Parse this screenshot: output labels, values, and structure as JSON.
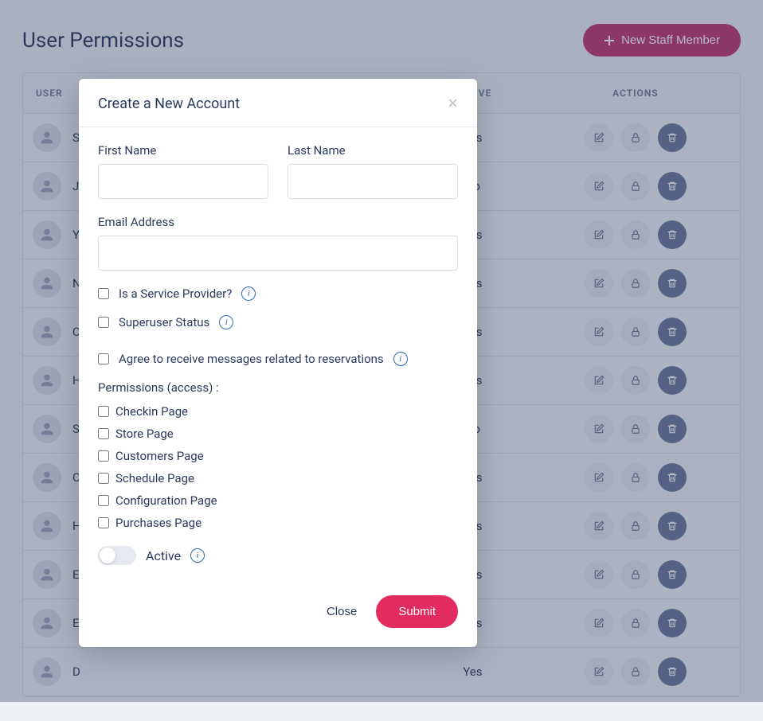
{
  "header": {
    "title": "User Permissions",
    "new_btn": "New Staff Member"
  },
  "table": {
    "columns": {
      "user": "USER",
      "sp": "?",
      "active": "ACTIVE",
      "actions": "ACTIONS"
    },
    "rows": [
      {
        "name": "S",
        "active": "Yes"
      },
      {
        "name": "J",
        "active": "No"
      },
      {
        "name": "Y",
        "active": "Yes"
      },
      {
        "name": "N",
        "active": "Yes"
      },
      {
        "name": "C",
        "active": "Yes"
      },
      {
        "name": "H",
        "active": "Yes"
      },
      {
        "name": "S",
        "active": "No"
      },
      {
        "name": "C",
        "active": "Yes"
      },
      {
        "name": "H",
        "active": "Yes"
      },
      {
        "name": "E",
        "active": "Yes"
      },
      {
        "name": "E",
        "active": "Yes"
      },
      {
        "name": "D",
        "active": "Yes"
      }
    ]
  },
  "modal": {
    "title": "Create a New Account",
    "first_name_label": "First Name",
    "last_name_label": "Last Name",
    "email_label": "Email Address",
    "is_sp": "Is a Service Provider?",
    "superuser": "Superuser Status",
    "agree": "Agree to receive messages related to reservations",
    "perm_title": "Permissions (access) :",
    "perms": [
      "Checkin Page",
      "Store Page",
      "Customers Page",
      "Schedule Page",
      "Configuration Page",
      "Purchases Page"
    ],
    "active_label": "Active",
    "close_btn": "Close",
    "submit_btn": "Submit"
  }
}
